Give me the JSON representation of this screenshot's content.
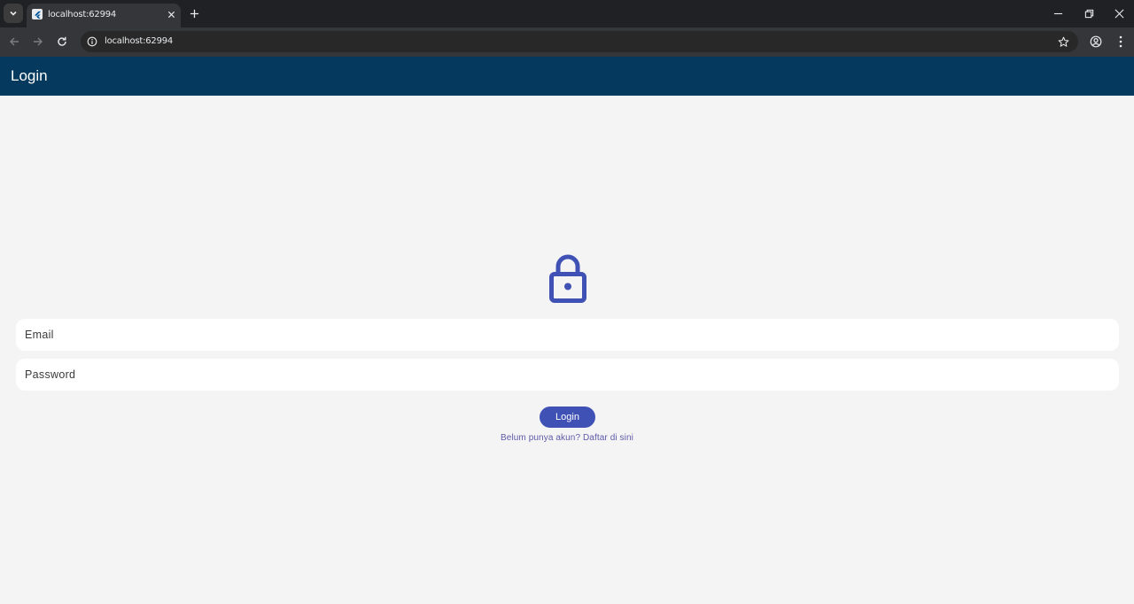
{
  "browser": {
    "tab": {
      "title": "localhost:62994"
    },
    "address_bar": {
      "url": "localhost:62994"
    },
    "icons": {
      "tab_menu": "chevron-down-icon",
      "favicon": "flutter-icon",
      "tab_close": "close-icon",
      "new_tab": "plus-icon",
      "minimize": "minimize-icon",
      "restore": "restore-icon",
      "close": "close-icon",
      "back": "arrow-left-icon",
      "forward": "arrow-right-icon",
      "reload": "reload-icon",
      "site_info": "info-icon",
      "bookmark": "star-icon",
      "profile": "profile-icon",
      "menu": "more-vert-icon"
    }
  },
  "app": {
    "appbar": {
      "title": "Login",
      "color": "#053a5e"
    },
    "icon": "lock-icon",
    "form": {
      "email": {
        "placeholder": "Email",
        "value": ""
      },
      "password": {
        "placeholder": "Password",
        "value": ""
      },
      "login_button": "Login",
      "register_link": "Belum punya akun? Daftar di sini"
    },
    "colors": {
      "primary": "#3f51b5",
      "background": "#f4f4f4",
      "link": "#5e5aa8"
    }
  }
}
